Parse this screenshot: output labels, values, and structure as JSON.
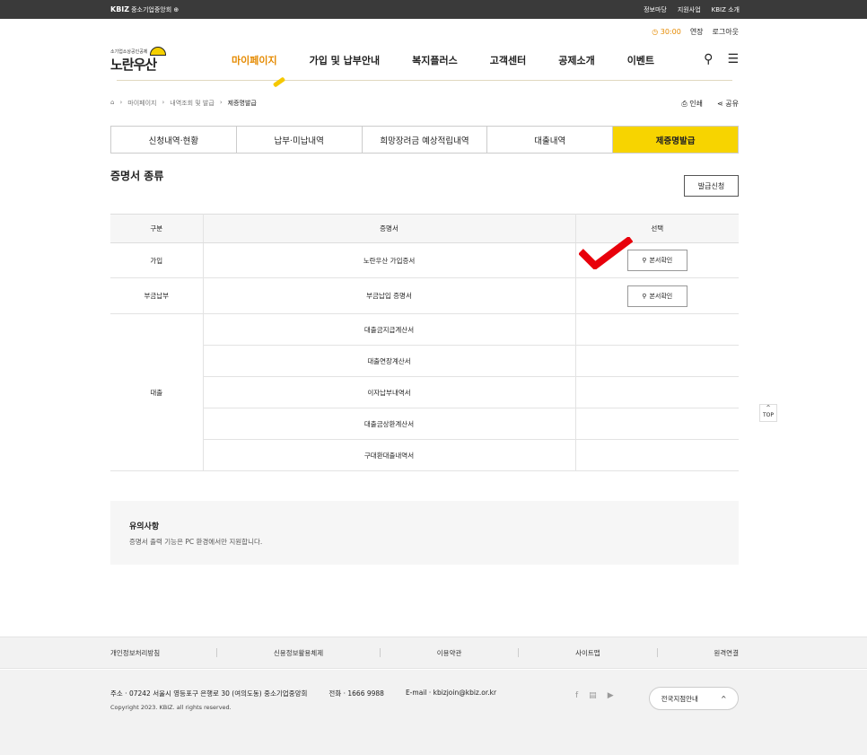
{
  "topbar": {
    "brand": "KBIZ",
    "brand_sub": "중소기업중앙회",
    "links": [
      "정보마당",
      "지원사업",
      "KBIZ 소개"
    ]
  },
  "util": {
    "timer": "30:00",
    "extend": "연장",
    "logout": "로그아웃"
  },
  "logo": {
    "small": "소기업소상공인공제",
    "big": "노란우산"
  },
  "gnb": [
    "마이페이지",
    "가입 및 납부안내",
    "복지플러스",
    "고객센터",
    "공제소개",
    "이벤트"
  ],
  "breadcrumb": [
    "마이페이지",
    "내역조회 및 발급",
    "제증명발급"
  ],
  "actions": {
    "print": "인쇄",
    "share": "공유"
  },
  "tabs": [
    "신청내역·현황",
    "납부·미납내역",
    "희망장려금 예상적립내역",
    "대출내역",
    "제증명발급"
  ],
  "section_title": "증명서 종류",
  "issue_button": "발급신청",
  "table": {
    "headers": [
      "구분",
      "증명서",
      "선택"
    ],
    "rows": [
      {
        "group": "가입",
        "name": "노란우산 가입증서",
        "button": "본서확인"
      },
      {
        "group": "부금납부",
        "name": "부금납입 증명서",
        "button": "본서확인"
      }
    ],
    "loan_group": "대출",
    "loan_rows": [
      "대출금지급계산서",
      "대출연장계산서",
      "이자납부내역서",
      "대출금상환계산서",
      "구대환대출내역서"
    ]
  },
  "top_button": "TOP",
  "notice": {
    "title": "유의사항",
    "text": "증명서 출력 기능은 PC 환경에서만 지원합니다."
  },
  "footer": {
    "links": [
      "개인정보처리방침",
      "신용정보활용체제",
      "이용약관",
      "사이트맵",
      "원격연결"
    ],
    "address": "주소 · 07242 서울시 영등포구 은행로 30 (여의도동) 중소기업중앙회",
    "phone": "전화 · 1666 9988",
    "email": "E-mail · kbizjoin@kbiz.or.kr",
    "copyright": "Copyright 2023. KBIZ. all rights reserved.",
    "branch": "전국지점안내"
  },
  "colors": {
    "accent": "#f7d400",
    "orange": "#e58a00",
    "check": "#e8000b"
  }
}
